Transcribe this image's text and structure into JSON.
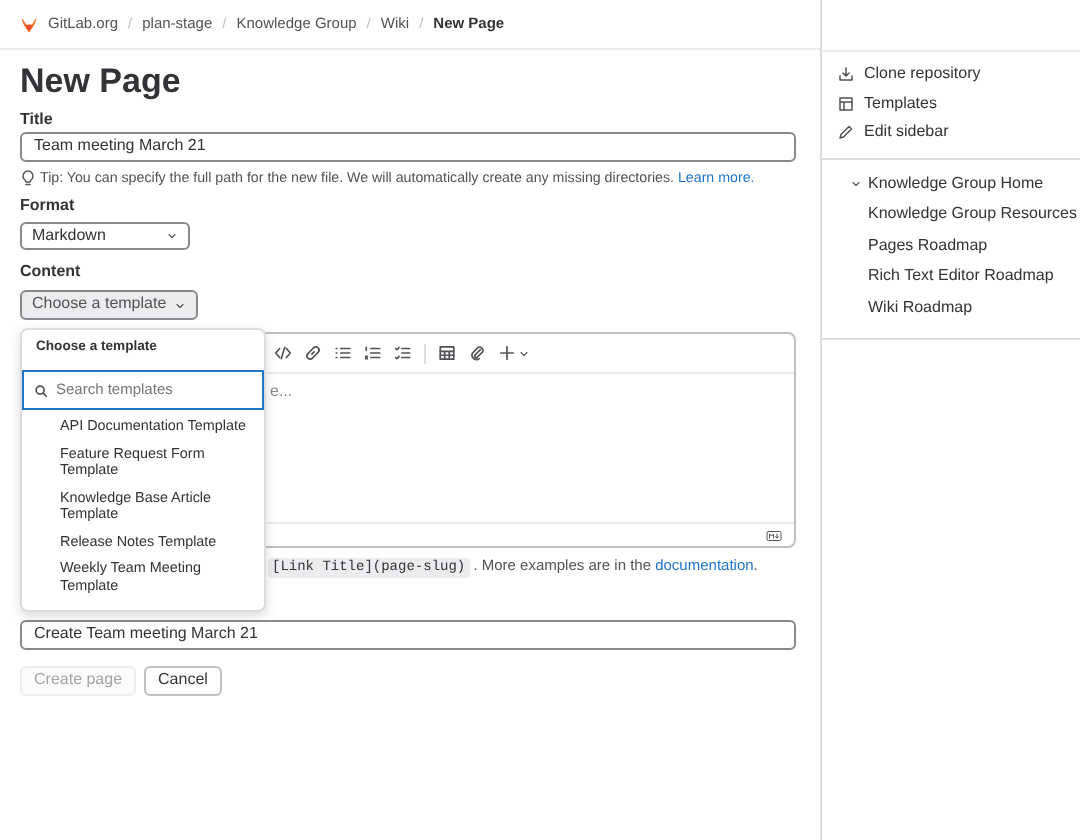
{
  "breadcrumbs": [
    {
      "label": "GitLab.org",
      "current": false
    },
    {
      "separator": "/",
      "label": "plan-stage",
      "current": false
    },
    {
      "separator": "/",
      "label": "Knowledge Group",
      "current": false
    },
    {
      "separator": "/",
      "label": "Wiki",
      "current": false
    },
    {
      "separator": "/",
      "label": "New Page",
      "current": true
    }
  ],
  "heading": "New Page",
  "title_field": {
    "label": "Title",
    "value": "Team meeting March 21"
  },
  "tip": {
    "text": "Tip: You can specify the full path for the new file. We will automatically create any missing directories.",
    "link": "Learn more."
  },
  "format": {
    "label": "Format",
    "value": "Markdown"
  },
  "content": {
    "label": "Content",
    "template_button": "Choose a template"
  },
  "editor": {
    "placeholder_fragment": "e..."
  },
  "hint": {
    "code": "[Link Title](page-slug)",
    "text": ". More examples are in the",
    "link": "documentation",
    "end": "."
  },
  "commit": {
    "value": "Create Team meeting March 21"
  },
  "buttons": [
    {
      "label": "Create page",
      "disabled": true
    },
    {
      "label": "Cancel",
      "disabled": false
    }
  ],
  "template_menu": {
    "title": "Choose a template",
    "search_placeholder": "Search templates",
    "items": [
      "API Documentation Template",
      "Feature Request Form Template",
      "Knowledge Base Article Template",
      "Release Notes Template",
      "Weekly Team Meeting Template"
    ]
  },
  "sidebar": {
    "actions": [
      "Clone repository",
      "Templates",
      "Edit sidebar"
    ],
    "pages": [
      {
        "label": "Knowledge Group Home",
        "kind": "folder",
        "expanded": true
      },
      {
        "label": "Knowledge Group Resources",
        "kind": "page"
      },
      {
        "label": "Pages Roadmap",
        "kind": "page"
      },
      {
        "label": "Rich Text Editor Roadmap",
        "kind": "page"
      },
      {
        "label": "Wiki Roadmap",
        "kind": "page"
      }
    ]
  }
}
